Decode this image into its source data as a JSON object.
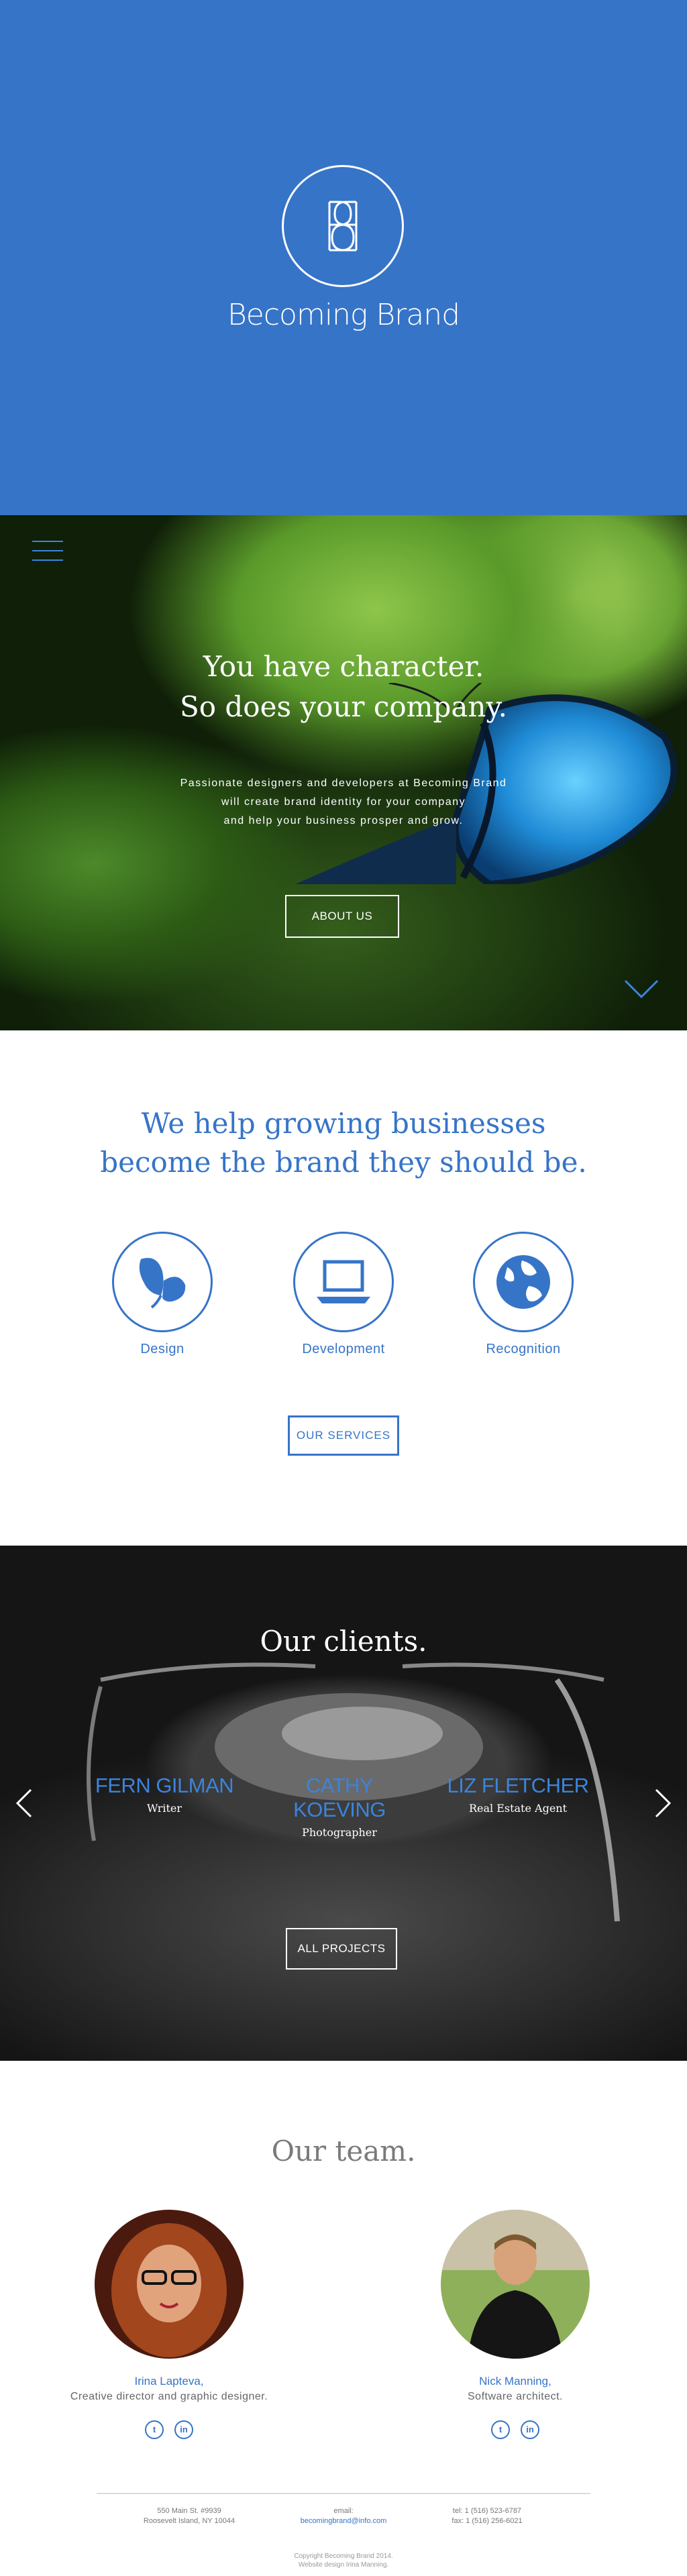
{
  "hero": {
    "logo_icon": "bb-monogram-icon",
    "brand_name": "Becoming Brand",
    "background": "#3674c8"
  },
  "intro": {
    "menu_icon": "hamburger-menu-icon",
    "tagline_line1": "You have character.",
    "tagline_line2": "So does your company.",
    "sub_line1": "Passionate designers and developers at Becoming Brand",
    "sub_line2": "will create brand identity for your company",
    "sub_line3": "and help your business prosper and grow.",
    "about_button": "ABOUT US",
    "scroll_icon": "chevron-down-icon"
  },
  "services": {
    "title_line1": "We help growing businesses",
    "title_line2": "become the brand they should be.",
    "items": [
      {
        "label": "Design",
        "icon": "butterfly-icon"
      },
      {
        "label": "Development",
        "icon": "laptop-icon"
      },
      {
        "label": "Recognition",
        "icon": "globe-icon"
      }
    ],
    "button": "OUR SERVICES"
  },
  "clients": {
    "title": "Our clients.",
    "items": [
      {
        "name": "FERN GILMAN",
        "role": "Writer"
      },
      {
        "name": "CATHY KOEVING",
        "role": "Photographer"
      },
      {
        "name": "LIZ FLETCHER",
        "role": "Real Estate Agent"
      }
    ],
    "prev_icon": "chevron-left-icon",
    "next_icon": "chevron-right-icon",
    "button": "ALL PROJECTS"
  },
  "team": {
    "title": "Our team.",
    "members": [
      {
        "name": "Irina Lapteva,",
        "title": "Creative director and graphic designer."
      },
      {
        "name": "Nick Manning,",
        "title": "Software architect."
      }
    ],
    "social_twitter": "t",
    "social_linkedin": "in"
  },
  "footer": {
    "address_line1": "550 Main St. #9939",
    "address_line2": "Roosevelt Island, NY 10044",
    "email_label": "email:",
    "email": "becomingbrand@info.com",
    "phone_line1": "tel: 1 (516) 523-6787",
    "phone_line2": "fax: 1 (516) 256-6021",
    "copyright_line1": "Copyright Becoming Brand 2014.",
    "copyright_line2": "Website design Irina Manning."
  },
  "colors": {
    "accent": "#3674c8",
    "link": "#3b84dd"
  }
}
